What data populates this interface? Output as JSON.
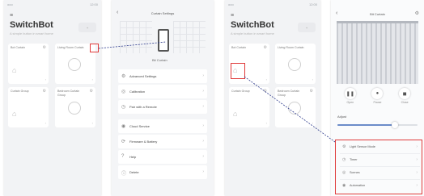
{
  "screen1": {
    "status_left": "ooo",
    "status_right": "12:00",
    "title": "SwitchBot",
    "subtitle": "A simple button in smart home",
    "add_label": "+",
    "devices": [
      {
        "label": "Bot Curtain",
        "icon": "⌂"
      },
      {
        "label": "Living Room Curtain",
        "icon": "⏻"
      },
      {
        "label": "Curtain Group",
        "icon": "⌂"
      },
      {
        "label": "Bedroom Curtain Group",
        "icon": "⏻"
      }
    ]
  },
  "screen2": {
    "back": "‹",
    "title": "Curtain Settings",
    "device_name": "Bit Curtain",
    "menu": [
      {
        "icon": "⚙",
        "label": "Advanced Settings"
      },
      {
        "icon": "◎",
        "label": "Calibration"
      },
      {
        "icon": "◷",
        "label": "Pair with a Remote"
      },
      {
        "icon": "◉",
        "label": "Cloud Service"
      },
      {
        "icon": "⟳",
        "label": "Firmware & Battery"
      },
      {
        "icon": "?",
        "label": "Help"
      },
      {
        "icon": "ⓘ",
        "label": "Delete"
      }
    ]
  },
  "screen3": {
    "status_left": "ooo",
    "status_right": "12:00",
    "title": "SwitchBot",
    "subtitle": "A simple button in smart home",
    "add_label": "+",
    "devices": [
      {
        "label": "Bot Curtain",
        "icon": "⌂"
      },
      {
        "label": "Living Room Curtain",
        "icon": "⏻"
      },
      {
        "label": "Curtain Group",
        "icon": "⌂"
      },
      {
        "label": "Bedroom Curtain Group",
        "icon": "⏻"
      }
    ]
  },
  "screen4": {
    "back": "‹",
    "title": "Bit Curtain",
    "gear": "⚙",
    "controls": [
      {
        "icon": "❚❚",
        "label": "Open"
      },
      {
        "icon": "●",
        "label": "Pause"
      },
      {
        "icon": "◼",
        "label": "Close"
      }
    ],
    "slider_label": "Adjust",
    "slider_value": 0.72,
    "menu": [
      {
        "icon": "⚙",
        "label": "Light Sensor Mode"
      },
      {
        "icon": "◷",
        "label": "Timer"
      },
      {
        "icon": "◎",
        "label": "Scenes"
      },
      {
        "icon": "◉",
        "label": "Automation"
      }
    ]
  },
  "colors": {
    "highlight": "#e03a3a",
    "connector": "#2d3a8c"
  }
}
